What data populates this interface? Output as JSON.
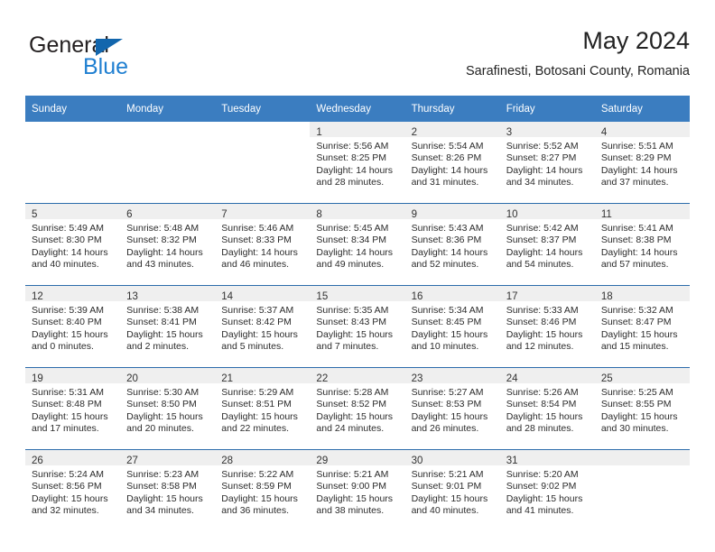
{
  "brand": {
    "name_top": "General",
    "name_bottom": "Blue"
  },
  "header": {
    "title": "May 2024",
    "subtitle": "Sarafinesti, Botosani County, Romania"
  },
  "colors": {
    "header_blue": "#3b7dc0",
    "row_divider_blue": "#2b6cab",
    "daynum_band": "#efefef",
    "logo_blue": "#1f7fd1",
    "logo_triangle": "#1266ad"
  },
  "weekdays": [
    "Sunday",
    "Monday",
    "Tuesday",
    "Wednesday",
    "Thursday",
    "Friday",
    "Saturday"
  ],
  "weeks": [
    [
      {
        "day": "",
        "sunrise": "",
        "sunset": "",
        "daylight1": "",
        "daylight2": "",
        "empty": true,
        "no_band": true
      },
      {
        "day": "",
        "sunrise": "",
        "sunset": "",
        "daylight1": "",
        "daylight2": "",
        "empty": true,
        "no_band": true
      },
      {
        "day": "",
        "sunrise": "",
        "sunset": "",
        "daylight1": "",
        "daylight2": "",
        "empty": true,
        "no_band": true
      },
      {
        "day": "1",
        "sunrise": "Sunrise: 5:56 AM",
        "sunset": "Sunset: 8:25 PM",
        "daylight1": "Daylight: 14 hours",
        "daylight2": "and 28 minutes."
      },
      {
        "day": "2",
        "sunrise": "Sunrise: 5:54 AM",
        "sunset": "Sunset: 8:26 PM",
        "daylight1": "Daylight: 14 hours",
        "daylight2": "and 31 minutes."
      },
      {
        "day": "3",
        "sunrise": "Sunrise: 5:52 AM",
        "sunset": "Sunset: 8:27 PM",
        "daylight1": "Daylight: 14 hours",
        "daylight2": "and 34 minutes."
      },
      {
        "day": "4",
        "sunrise": "Sunrise: 5:51 AM",
        "sunset": "Sunset: 8:29 PM",
        "daylight1": "Daylight: 14 hours",
        "daylight2": "and 37 minutes."
      }
    ],
    [
      {
        "day": "5",
        "sunrise": "Sunrise: 5:49 AM",
        "sunset": "Sunset: 8:30 PM",
        "daylight1": "Daylight: 14 hours",
        "daylight2": "and 40 minutes."
      },
      {
        "day": "6",
        "sunrise": "Sunrise: 5:48 AM",
        "sunset": "Sunset: 8:32 PM",
        "daylight1": "Daylight: 14 hours",
        "daylight2": "and 43 minutes."
      },
      {
        "day": "7",
        "sunrise": "Sunrise: 5:46 AM",
        "sunset": "Sunset: 8:33 PM",
        "daylight1": "Daylight: 14 hours",
        "daylight2": "and 46 minutes."
      },
      {
        "day": "8",
        "sunrise": "Sunrise: 5:45 AM",
        "sunset": "Sunset: 8:34 PM",
        "daylight1": "Daylight: 14 hours",
        "daylight2": "and 49 minutes."
      },
      {
        "day": "9",
        "sunrise": "Sunrise: 5:43 AM",
        "sunset": "Sunset: 8:36 PM",
        "daylight1": "Daylight: 14 hours",
        "daylight2": "and 52 minutes."
      },
      {
        "day": "10",
        "sunrise": "Sunrise: 5:42 AM",
        "sunset": "Sunset: 8:37 PM",
        "daylight1": "Daylight: 14 hours",
        "daylight2": "and 54 minutes."
      },
      {
        "day": "11",
        "sunrise": "Sunrise: 5:41 AM",
        "sunset": "Sunset: 8:38 PM",
        "daylight1": "Daylight: 14 hours",
        "daylight2": "and 57 minutes."
      }
    ],
    [
      {
        "day": "12",
        "sunrise": "Sunrise: 5:39 AM",
        "sunset": "Sunset: 8:40 PM",
        "daylight1": "Daylight: 15 hours",
        "daylight2": "and 0 minutes."
      },
      {
        "day": "13",
        "sunrise": "Sunrise: 5:38 AM",
        "sunset": "Sunset: 8:41 PM",
        "daylight1": "Daylight: 15 hours",
        "daylight2": "and 2 minutes."
      },
      {
        "day": "14",
        "sunrise": "Sunrise: 5:37 AM",
        "sunset": "Sunset: 8:42 PM",
        "daylight1": "Daylight: 15 hours",
        "daylight2": "and 5 minutes."
      },
      {
        "day": "15",
        "sunrise": "Sunrise: 5:35 AM",
        "sunset": "Sunset: 8:43 PM",
        "daylight1": "Daylight: 15 hours",
        "daylight2": "and 7 minutes."
      },
      {
        "day": "16",
        "sunrise": "Sunrise: 5:34 AM",
        "sunset": "Sunset: 8:45 PM",
        "daylight1": "Daylight: 15 hours",
        "daylight2": "and 10 minutes."
      },
      {
        "day": "17",
        "sunrise": "Sunrise: 5:33 AM",
        "sunset": "Sunset: 8:46 PM",
        "daylight1": "Daylight: 15 hours",
        "daylight2": "and 12 minutes."
      },
      {
        "day": "18",
        "sunrise": "Sunrise: 5:32 AM",
        "sunset": "Sunset: 8:47 PM",
        "daylight1": "Daylight: 15 hours",
        "daylight2": "and 15 minutes."
      }
    ],
    [
      {
        "day": "19",
        "sunrise": "Sunrise: 5:31 AM",
        "sunset": "Sunset: 8:48 PM",
        "daylight1": "Daylight: 15 hours",
        "daylight2": "and 17 minutes."
      },
      {
        "day": "20",
        "sunrise": "Sunrise: 5:30 AM",
        "sunset": "Sunset: 8:50 PM",
        "daylight1": "Daylight: 15 hours",
        "daylight2": "and 20 minutes."
      },
      {
        "day": "21",
        "sunrise": "Sunrise: 5:29 AM",
        "sunset": "Sunset: 8:51 PM",
        "daylight1": "Daylight: 15 hours",
        "daylight2": "and 22 minutes."
      },
      {
        "day": "22",
        "sunrise": "Sunrise: 5:28 AM",
        "sunset": "Sunset: 8:52 PM",
        "daylight1": "Daylight: 15 hours",
        "daylight2": "and 24 minutes."
      },
      {
        "day": "23",
        "sunrise": "Sunrise: 5:27 AM",
        "sunset": "Sunset: 8:53 PM",
        "daylight1": "Daylight: 15 hours",
        "daylight2": "and 26 minutes."
      },
      {
        "day": "24",
        "sunrise": "Sunrise: 5:26 AM",
        "sunset": "Sunset: 8:54 PM",
        "daylight1": "Daylight: 15 hours",
        "daylight2": "and 28 minutes."
      },
      {
        "day": "25",
        "sunrise": "Sunrise: 5:25 AM",
        "sunset": "Sunset: 8:55 PM",
        "daylight1": "Daylight: 15 hours",
        "daylight2": "and 30 minutes."
      }
    ],
    [
      {
        "day": "26",
        "sunrise": "Sunrise: 5:24 AM",
        "sunset": "Sunset: 8:56 PM",
        "daylight1": "Daylight: 15 hours",
        "daylight2": "and 32 minutes."
      },
      {
        "day": "27",
        "sunrise": "Sunrise: 5:23 AM",
        "sunset": "Sunset: 8:58 PM",
        "daylight1": "Daylight: 15 hours",
        "daylight2": "and 34 minutes."
      },
      {
        "day": "28",
        "sunrise": "Sunrise: 5:22 AM",
        "sunset": "Sunset: 8:59 PM",
        "daylight1": "Daylight: 15 hours",
        "daylight2": "and 36 minutes."
      },
      {
        "day": "29",
        "sunrise": "Sunrise: 5:21 AM",
        "sunset": "Sunset: 9:00 PM",
        "daylight1": "Daylight: 15 hours",
        "daylight2": "and 38 minutes."
      },
      {
        "day": "30",
        "sunrise": "Sunrise: 5:21 AM",
        "sunset": "Sunset: 9:01 PM",
        "daylight1": "Daylight: 15 hours",
        "daylight2": "and 40 minutes."
      },
      {
        "day": "31",
        "sunrise": "Sunrise: 5:20 AM",
        "sunset": "Sunset: 9:02 PM",
        "daylight1": "Daylight: 15 hours",
        "daylight2": "and 41 minutes."
      },
      {
        "day": "",
        "sunrise": "",
        "sunset": "",
        "daylight1": "",
        "daylight2": "",
        "empty": true,
        "no_band": false
      }
    ]
  ]
}
